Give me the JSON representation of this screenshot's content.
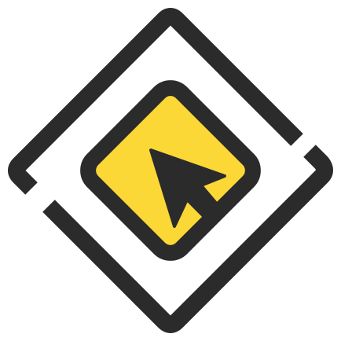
{
  "icon": {
    "name": "cursor-diamond-icon",
    "colors": {
      "stroke": "#2b2b2b",
      "fill": "#fcd837",
      "background": "#ffffff"
    }
  }
}
